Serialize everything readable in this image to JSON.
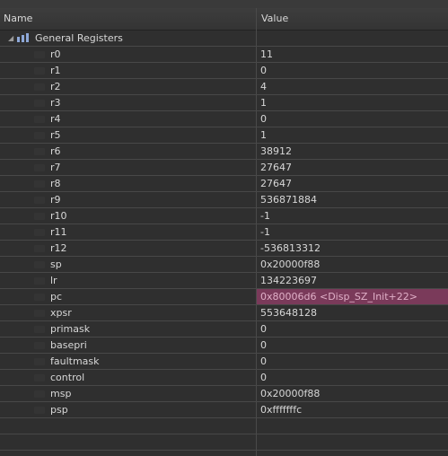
{
  "columns": {
    "name": "Name",
    "value": "Value"
  },
  "group": {
    "label": "General Registers",
    "expanded": true,
    "icon": "register-group-icon"
  },
  "colors": {
    "highlight_row_bg": "#7a3a5a",
    "highlight_row_text": "#e0b0c8"
  },
  "registers": [
    {
      "name": "r0",
      "value": "11",
      "highlight": false
    },
    {
      "name": "r1",
      "value": "0",
      "highlight": false
    },
    {
      "name": "r2",
      "value": "4",
      "highlight": false
    },
    {
      "name": "r3",
      "value": "1",
      "highlight": false
    },
    {
      "name": "r4",
      "value": "0",
      "highlight": false
    },
    {
      "name": "r5",
      "value": "1",
      "highlight": false
    },
    {
      "name": "r6",
      "value": "38912",
      "highlight": false
    },
    {
      "name": "r7",
      "value": "27647",
      "highlight": false
    },
    {
      "name": "r8",
      "value": "27647",
      "highlight": false
    },
    {
      "name": "r9",
      "value": "536871884",
      "highlight": false
    },
    {
      "name": "r10",
      "value": "-1",
      "highlight": false
    },
    {
      "name": "r11",
      "value": "-1",
      "highlight": false
    },
    {
      "name": "r12",
      "value": "-536813312",
      "highlight": false
    },
    {
      "name": "sp",
      "value": "0x20000f88",
      "highlight": false
    },
    {
      "name": "lr",
      "value": "134223697",
      "highlight": false
    },
    {
      "name": "pc",
      "value": "0x80006d6 <Disp_SZ_Init+22>",
      "highlight": true
    },
    {
      "name": "xpsr",
      "value": "553648128",
      "highlight": false
    },
    {
      "name": "primask",
      "value": "0",
      "highlight": false
    },
    {
      "name": "basepri",
      "value": "0",
      "highlight": false
    },
    {
      "name": "faultmask",
      "value": "0",
      "highlight": false
    },
    {
      "name": "control",
      "value": "0",
      "highlight": false
    },
    {
      "name": "msp",
      "value": "0x20000f88",
      "highlight": false
    },
    {
      "name": "psp",
      "value": "0xfffffffc",
      "highlight": false
    }
  ]
}
